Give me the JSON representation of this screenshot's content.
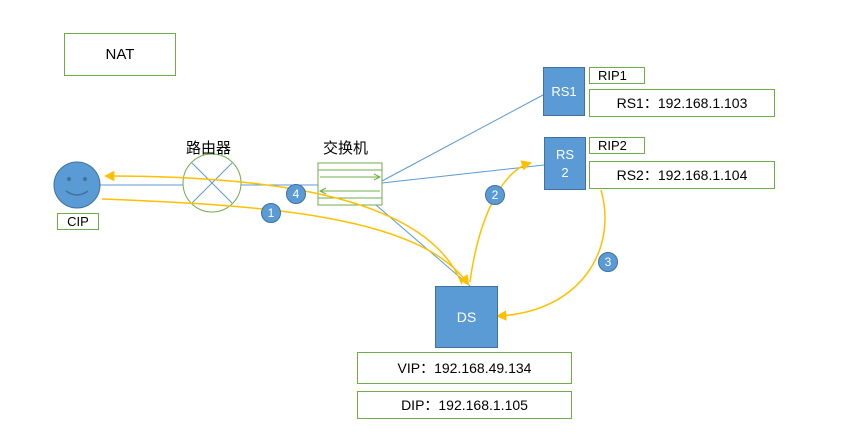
{
  "title": "NAT",
  "nodes": {
    "cip": "CIP",
    "router": "路由器",
    "switch": "交换机",
    "rs1": "RS1",
    "rs2_line1": "RS",
    "rs2_line2": "2",
    "ds": "DS"
  },
  "labels": {
    "rip1": "RIP1",
    "rip2": "RIP2",
    "rs1_ip": "RS1：192.168.1.103",
    "rs2_ip": "RS2：192.168.1.104",
    "vip": "VIP：192.168.49.134",
    "dip": "DIP：192.168.1.105"
  },
  "steps": [
    "1",
    "2",
    "3",
    "4"
  ],
  "colors": {
    "node_fill": "#5b9bd5",
    "link_line": "#5b9bd5",
    "flow_arrow": "#ffc000",
    "box_border": "#70ad47"
  }
}
